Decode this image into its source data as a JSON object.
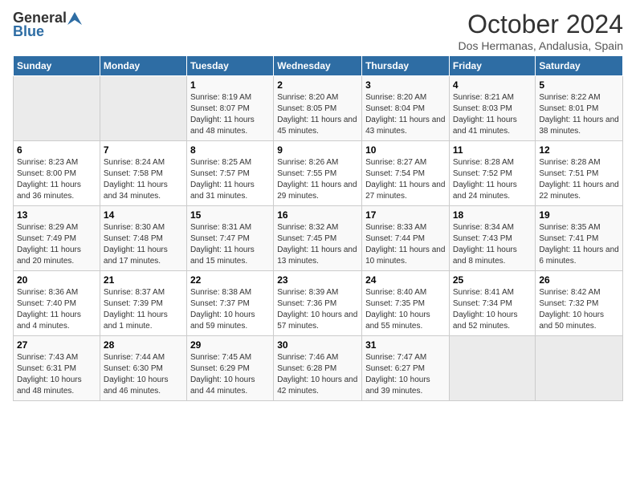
{
  "header": {
    "logo_general": "General",
    "logo_blue": "Blue",
    "month_title": "October 2024",
    "location": "Dos Hermanas, Andalusia, Spain"
  },
  "days_of_week": [
    "Sunday",
    "Monday",
    "Tuesday",
    "Wednesday",
    "Thursday",
    "Friday",
    "Saturday"
  ],
  "weeks": [
    [
      {
        "day": "",
        "sunrise": "",
        "sunset": "",
        "daylight": ""
      },
      {
        "day": "",
        "sunrise": "",
        "sunset": "",
        "daylight": ""
      },
      {
        "day": "1",
        "sunrise": "Sunrise: 8:19 AM",
        "sunset": "Sunset: 8:07 PM",
        "daylight": "Daylight: 11 hours and 48 minutes."
      },
      {
        "day": "2",
        "sunrise": "Sunrise: 8:20 AM",
        "sunset": "Sunset: 8:05 PM",
        "daylight": "Daylight: 11 hours and 45 minutes."
      },
      {
        "day": "3",
        "sunrise": "Sunrise: 8:20 AM",
        "sunset": "Sunset: 8:04 PM",
        "daylight": "Daylight: 11 hours and 43 minutes."
      },
      {
        "day": "4",
        "sunrise": "Sunrise: 8:21 AM",
        "sunset": "Sunset: 8:03 PM",
        "daylight": "Daylight: 11 hours and 41 minutes."
      },
      {
        "day": "5",
        "sunrise": "Sunrise: 8:22 AM",
        "sunset": "Sunset: 8:01 PM",
        "daylight": "Daylight: 11 hours and 38 minutes."
      }
    ],
    [
      {
        "day": "6",
        "sunrise": "Sunrise: 8:23 AM",
        "sunset": "Sunset: 8:00 PM",
        "daylight": "Daylight: 11 hours and 36 minutes."
      },
      {
        "day": "7",
        "sunrise": "Sunrise: 8:24 AM",
        "sunset": "Sunset: 7:58 PM",
        "daylight": "Daylight: 11 hours and 34 minutes."
      },
      {
        "day": "8",
        "sunrise": "Sunrise: 8:25 AM",
        "sunset": "Sunset: 7:57 PM",
        "daylight": "Daylight: 11 hours and 31 minutes."
      },
      {
        "day": "9",
        "sunrise": "Sunrise: 8:26 AM",
        "sunset": "Sunset: 7:55 PM",
        "daylight": "Daylight: 11 hours and 29 minutes."
      },
      {
        "day": "10",
        "sunrise": "Sunrise: 8:27 AM",
        "sunset": "Sunset: 7:54 PM",
        "daylight": "Daylight: 11 hours and 27 minutes."
      },
      {
        "day": "11",
        "sunrise": "Sunrise: 8:28 AM",
        "sunset": "Sunset: 7:52 PM",
        "daylight": "Daylight: 11 hours and 24 minutes."
      },
      {
        "day": "12",
        "sunrise": "Sunrise: 8:28 AM",
        "sunset": "Sunset: 7:51 PM",
        "daylight": "Daylight: 11 hours and 22 minutes."
      }
    ],
    [
      {
        "day": "13",
        "sunrise": "Sunrise: 8:29 AM",
        "sunset": "Sunset: 7:49 PM",
        "daylight": "Daylight: 11 hours and 20 minutes."
      },
      {
        "day": "14",
        "sunrise": "Sunrise: 8:30 AM",
        "sunset": "Sunset: 7:48 PM",
        "daylight": "Daylight: 11 hours and 17 minutes."
      },
      {
        "day": "15",
        "sunrise": "Sunrise: 8:31 AM",
        "sunset": "Sunset: 7:47 PM",
        "daylight": "Daylight: 11 hours and 15 minutes."
      },
      {
        "day": "16",
        "sunrise": "Sunrise: 8:32 AM",
        "sunset": "Sunset: 7:45 PM",
        "daylight": "Daylight: 11 hours and 13 minutes."
      },
      {
        "day": "17",
        "sunrise": "Sunrise: 8:33 AM",
        "sunset": "Sunset: 7:44 PM",
        "daylight": "Daylight: 11 hours and 10 minutes."
      },
      {
        "day": "18",
        "sunrise": "Sunrise: 8:34 AM",
        "sunset": "Sunset: 7:43 PM",
        "daylight": "Daylight: 11 hours and 8 minutes."
      },
      {
        "day": "19",
        "sunrise": "Sunrise: 8:35 AM",
        "sunset": "Sunset: 7:41 PM",
        "daylight": "Daylight: 11 hours and 6 minutes."
      }
    ],
    [
      {
        "day": "20",
        "sunrise": "Sunrise: 8:36 AM",
        "sunset": "Sunset: 7:40 PM",
        "daylight": "Daylight: 11 hours and 4 minutes."
      },
      {
        "day": "21",
        "sunrise": "Sunrise: 8:37 AM",
        "sunset": "Sunset: 7:39 PM",
        "daylight": "Daylight: 11 hours and 1 minute."
      },
      {
        "day": "22",
        "sunrise": "Sunrise: 8:38 AM",
        "sunset": "Sunset: 7:37 PM",
        "daylight": "Daylight: 10 hours and 59 minutes."
      },
      {
        "day": "23",
        "sunrise": "Sunrise: 8:39 AM",
        "sunset": "Sunset: 7:36 PM",
        "daylight": "Daylight: 10 hours and 57 minutes."
      },
      {
        "day": "24",
        "sunrise": "Sunrise: 8:40 AM",
        "sunset": "Sunset: 7:35 PM",
        "daylight": "Daylight: 10 hours and 55 minutes."
      },
      {
        "day": "25",
        "sunrise": "Sunrise: 8:41 AM",
        "sunset": "Sunset: 7:34 PM",
        "daylight": "Daylight: 10 hours and 52 minutes."
      },
      {
        "day": "26",
        "sunrise": "Sunrise: 8:42 AM",
        "sunset": "Sunset: 7:32 PM",
        "daylight": "Daylight: 10 hours and 50 minutes."
      }
    ],
    [
      {
        "day": "27",
        "sunrise": "Sunrise: 7:43 AM",
        "sunset": "Sunset: 6:31 PM",
        "daylight": "Daylight: 10 hours and 48 minutes."
      },
      {
        "day": "28",
        "sunrise": "Sunrise: 7:44 AM",
        "sunset": "Sunset: 6:30 PM",
        "daylight": "Daylight: 10 hours and 46 minutes."
      },
      {
        "day": "29",
        "sunrise": "Sunrise: 7:45 AM",
        "sunset": "Sunset: 6:29 PM",
        "daylight": "Daylight: 10 hours and 44 minutes."
      },
      {
        "day": "30",
        "sunrise": "Sunrise: 7:46 AM",
        "sunset": "Sunset: 6:28 PM",
        "daylight": "Daylight: 10 hours and 42 minutes."
      },
      {
        "day": "31",
        "sunrise": "Sunrise: 7:47 AM",
        "sunset": "Sunset: 6:27 PM",
        "daylight": "Daylight: 10 hours and 39 minutes."
      },
      {
        "day": "",
        "sunrise": "",
        "sunset": "",
        "daylight": ""
      },
      {
        "day": "",
        "sunrise": "",
        "sunset": "",
        "daylight": ""
      }
    ]
  ]
}
